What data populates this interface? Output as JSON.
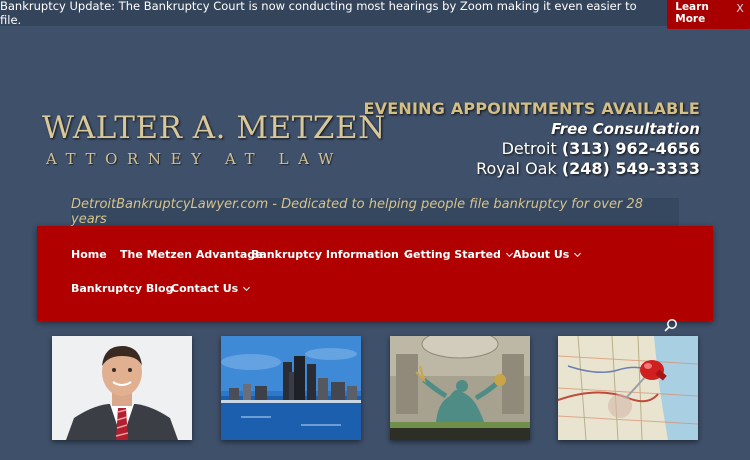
{
  "notice": {
    "message": "Bankruptcy Update: The Bankruptcy Court is now conducting most hearings by Zoom making it even easier to file.",
    "button_label": "Learn More",
    "close_label": "X"
  },
  "logo": {
    "name": "WALTER A. METZEN",
    "subtitle": "ATTORNEY AT LAW"
  },
  "contact": {
    "evening": "EVENING APPOINTMENTS AVAILABLE",
    "free": "Free Consultation",
    "offices": [
      {
        "city": "Detroit",
        "phone": "(313) 962-4656"
      },
      {
        "city": "Royal Oak",
        "phone": "(248) 549-3333"
      }
    ]
  },
  "tagline": "DetroitBankruptcyLawyer.com - Dedicated to helping people file bankruptcy for over 28 years",
  "nav": {
    "items": [
      {
        "label": "Home"
      },
      {
        "label": "The Metzen Advantage"
      },
      {
        "label": "Bankruptcy Information"
      },
      {
        "label": "Getting Started"
      },
      {
        "label": "About Us"
      },
      {
        "label": "Bankruptcy Blog"
      },
      {
        "label": "Contact Us"
      }
    ]
  },
  "icons": {
    "search": "search-icon",
    "dropdown": "chevron-down-icon"
  },
  "colors": {
    "background": "#3f506a",
    "nav": "#b00000",
    "gold": "#d3bf86"
  }
}
